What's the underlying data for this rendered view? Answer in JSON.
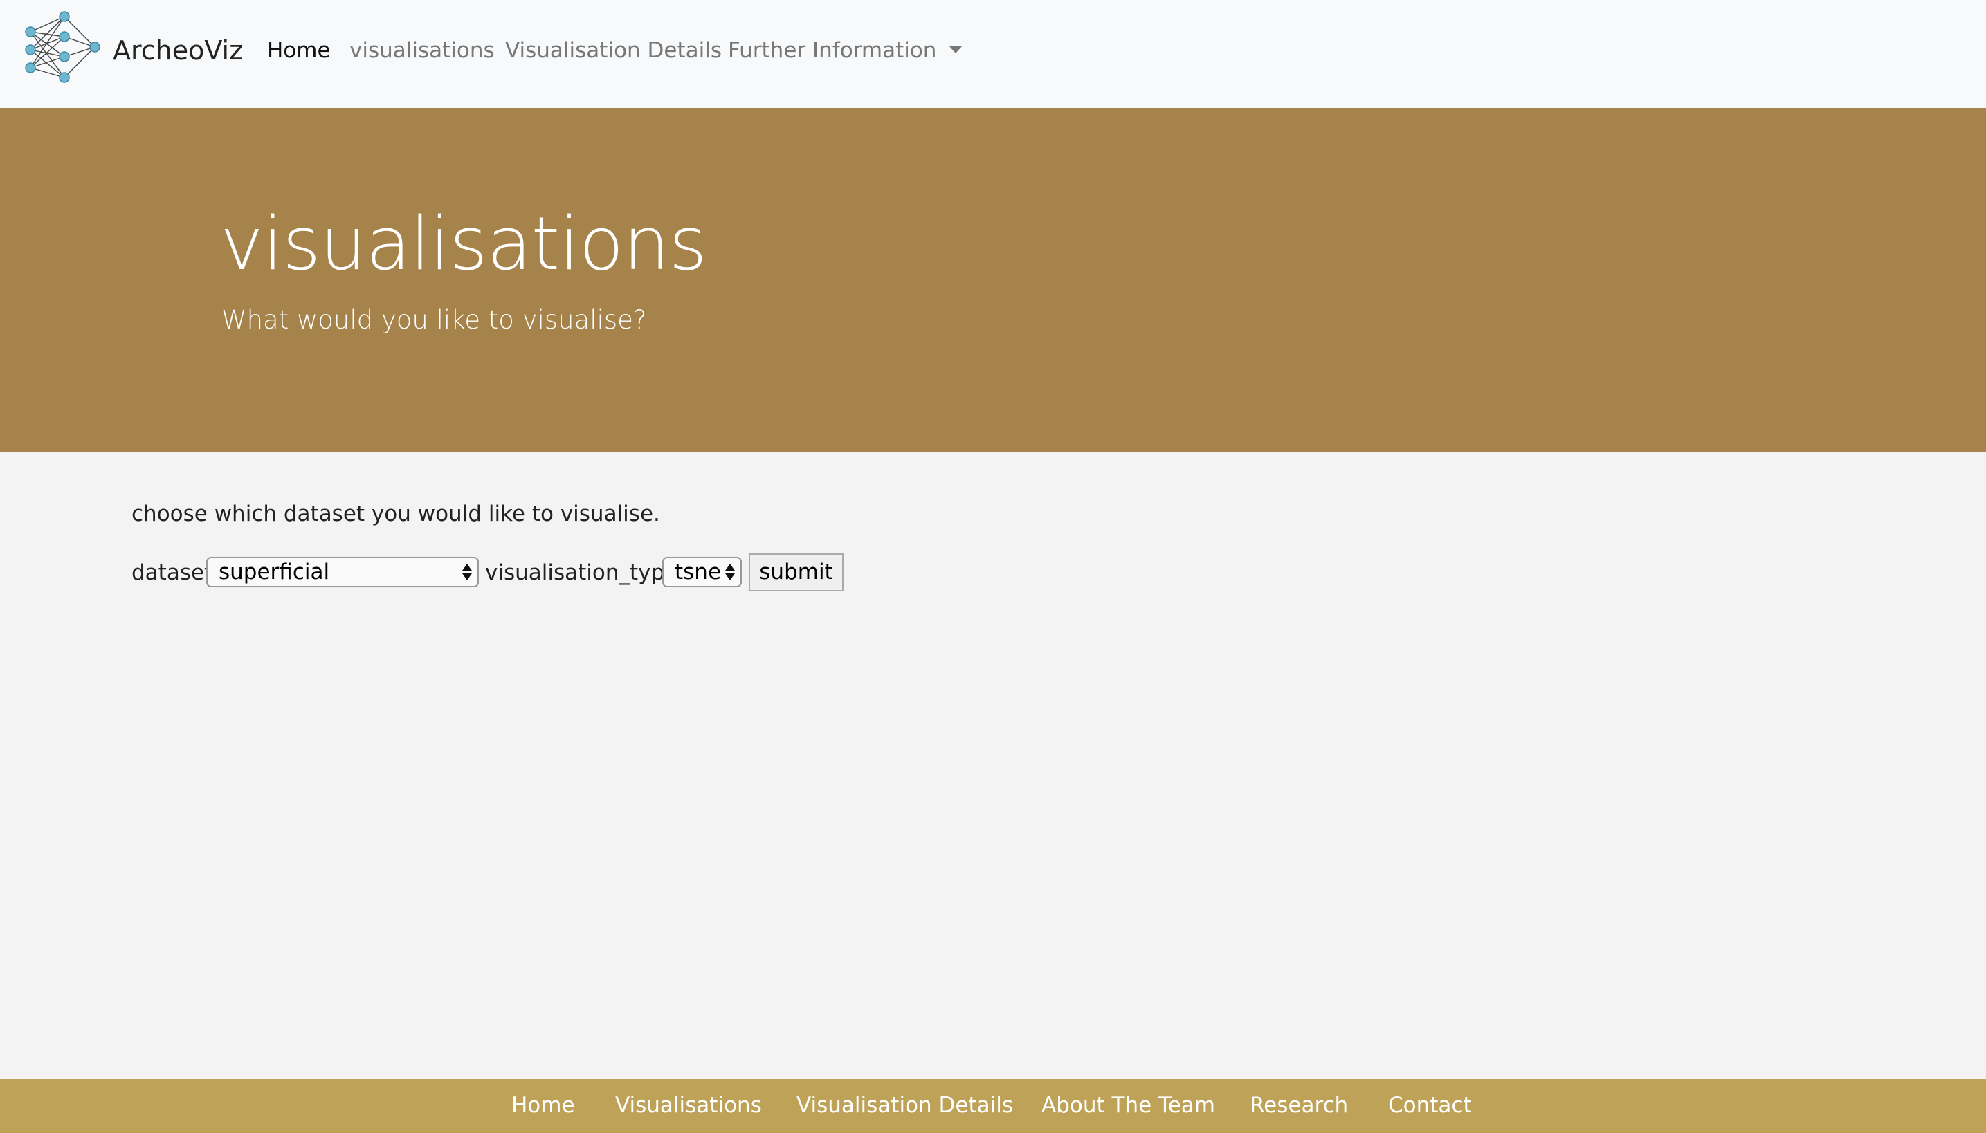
{
  "navbar": {
    "brand": "ArcheoViz",
    "logo_icon": "neural-network-icon",
    "links": [
      {
        "label": "Home",
        "active": true
      },
      {
        "label": "visualisations",
        "active": false
      },
      {
        "label": "Visualisation Details",
        "active": false
      },
      {
        "label": "Further Information",
        "active": false,
        "dropdown": true
      }
    ]
  },
  "hero": {
    "title": "visualisations",
    "subtitle": "What would you like to visualise?",
    "background_color": "#a6834b"
  },
  "form": {
    "intro": "choose which dataset you would like to visualise.",
    "dataset_label": "dataset",
    "dataset_value": "superficial",
    "visualisation_type_label": "visualisation_type",
    "visualisation_type_value": "tsne",
    "submit_label": "submit"
  },
  "footer": {
    "background_color": "#bda257",
    "links": [
      "Home",
      "Visualisations",
      "Visualisation Details",
      "About The Team",
      "Research",
      "Contact"
    ]
  }
}
